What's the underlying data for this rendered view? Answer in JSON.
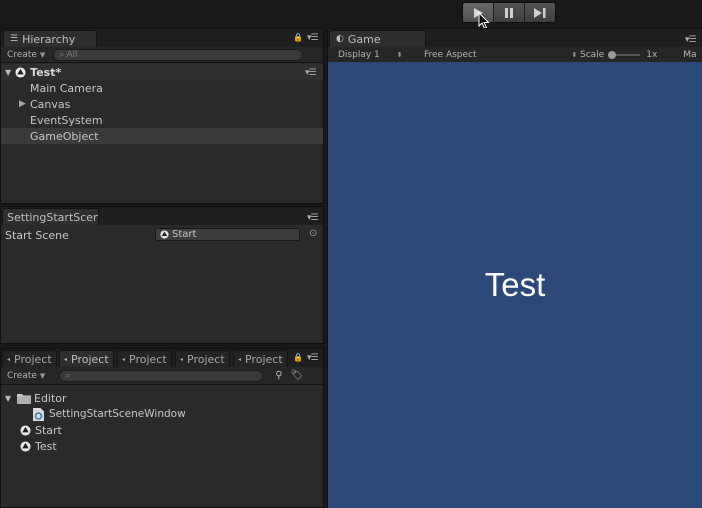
{
  "toolbar": {
    "buttons": [
      "play",
      "pause",
      "step"
    ]
  },
  "hierarchy": {
    "tab": "Hierarchy",
    "create": "Create",
    "search_placeholder": "All",
    "scene": "Test*",
    "items": [
      "Main Camera",
      "Canvas",
      "EventSystem",
      "GameObject"
    ],
    "selected": "GameObject"
  },
  "settings_window": {
    "tab": "SettingStartScen",
    "field_label": "Start Scene",
    "field_value": "Start"
  },
  "project": {
    "tabs": [
      "Project",
      "Project",
      "Project",
      "Project",
      "Project"
    ],
    "active_tab_index": 1,
    "create": "Create",
    "tree": [
      {
        "label": "Editor",
        "type": "folder",
        "depth": 0,
        "expanded": true
      },
      {
        "label": "SettingStartSceneWindow",
        "type": "script",
        "depth": 1
      },
      {
        "label": "Start",
        "type": "scene",
        "depth": 0
      },
      {
        "label": "Test",
        "type": "scene",
        "depth": 0
      }
    ]
  },
  "game": {
    "tab": "Game",
    "display": "Display 1",
    "aspect": "Free Aspect",
    "scale_label": "Scale",
    "scale_value": "1x",
    "maximize_label": "Ma",
    "content_text": "Test",
    "background_color": "#2b4878"
  }
}
